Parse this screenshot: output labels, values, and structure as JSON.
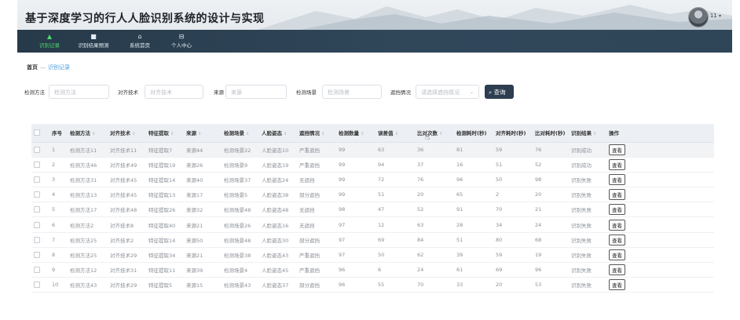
{
  "header": {
    "title": "基于深度学习的行人人脸识别系统的设计与实现",
    "user_label": "11",
    "nav": [
      {
        "label": "识别记录",
        "icon": "person-icon",
        "glyph": "▲",
        "active": true
      },
      {
        "label": "识别结果预测",
        "icon": "message-icon",
        "glyph": "■",
        "active": false
      },
      {
        "label": "系统首页",
        "icon": "home-icon",
        "glyph": "⌂",
        "active": false
      },
      {
        "label": "个人中心",
        "icon": "profile-icon",
        "glyph": "⊟",
        "active": false
      }
    ]
  },
  "breadcrumb": {
    "home": "首页",
    "sep": "—",
    "current": "识别记录"
  },
  "filters": {
    "method_label": "检测方法",
    "method_placeholder": "检测方法",
    "align_label": "对齐技术",
    "align_placeholder": "对齐技术",
    "source_label": "来源",
    "source_placeholder": "来源",
    "scene_label": "检测场景",
    "scene_placeholder": "检测场景",
    "occlusion_label": "遮挡情况",
    "occlusion_placeholder": "请选择遮挡情况",
    "query_label": "查询"
  },
  "table": {
    "columns": [
      "序号",
      "检测方法",
      "对齐技术",
      "特征提取",
      "来源",
      "检测场景",
      "人脸姿态",
      "遮挡情况",
      "检测数量",
      "误差值",
      "比对次数",
      "检测耗时(秒)",
      "对齐耗时(秒)",
      "比对耗时(秒)",
      "识别结果",
      "操作"
    ],
    "view_label": "查看",
    "rows": [
      [
        "1",
        "检测方法11",
        "对齐技术11",
        "特征提取7",
        "来源44",
        "检测场景22",
        "人脸姿态10",
        "严重遮挡",
        "99",
        "63",
        "36",
        "81",
        "59",
        "76",
        "识别成功"
      ],
      [
        "2",
        "检测方法46",
        "对齐技术49",
        "特征提取19",
        "来源26",
        "检测场景9",
        "人脸姿态19",
        "严重遮挡",
        "99",
        "94",
        "37",
        "16",
        "51",
        "52",
        "识别成功"
      ],
      [
        "3",
        "检测方法31",
        "对齐技术45",
        "特征提取14",
        "来源40",
        "检测场景37",
        "人脸姿态24",
        "无遮挡",
        "99",
        "72",
        "76",
        "96",
        "50",
        "98",
        "识别失败"
      ],
      [
        "4",
        "检测方法13",
        "对齐技术45",
        "特征提取13",
        "来源17",
        "检测场景5",
        "人脸姿态38",
        "部分遮挡",
        "99",
        "51",
        "20",
        "65",
        "2",
        "20",
        "识别失败"
      ],
      [
        "5",
        "检测方法17",
        "对齐技术48",
        "特征提取26",
        "来源32",
        "检测场景48",
        "人脸姿态48",
        "无遮挡",
        "98",
        "47",
        "52",
        "91",
        "70",
        "21",
        "识别失败"
      ],
      [
        "6",
        "检测方法2",
        "对齐技术8",
        "特征提取40",
        "来源21",
        "检测场景26",
        "人脸姿态16",
        "无遮挡",
        "97",
        "12",
        "63",
        "28",
        "34",
        "24",
        "识别失败"
      ],
      [
        "7",
        "检测方法25",
        "对齐技术2",
        "特征提取14",
        "来源50",
        "检测场景48",
        "人脸姿态30",
        "部分遮挡",
        "97",
        "69",
        "84",
        "51",
        "80",
        "68",
        "识别失败"
      ],
      [
        "8",
        "检测方法25",
        "对齐技术29",
        "特征提取34",
        "来源21",
        "检测场景38",
        "人脸姿态43",
        "严重遮挡",
        "97",
        "50",
        "62",
        "39",
        "59",
        "19",
        "识别失败"
      ],
      [
        "9",
        "检测方法12",
        "对齐技术31",
        "特征提取11",
        "来源39",
        "检测场景4",
        "人脸姿态45",
        "严重遮挡",
        "96",
        "6",
        "24",
        "61",
        "69",
        "96",
        "识别失败"
      ],
      [
        "10",
        "检测方法43",
        "对齐技术29",
        "特征提取5",
        "来源15",
        "检测场景43",
        "人脸姿态37",
        "部分遮挡",
        "96",
        "55",
        "70",
        "33",
        "20",
        "53",
        "识别失败"
      ]
    ]
  }
}
